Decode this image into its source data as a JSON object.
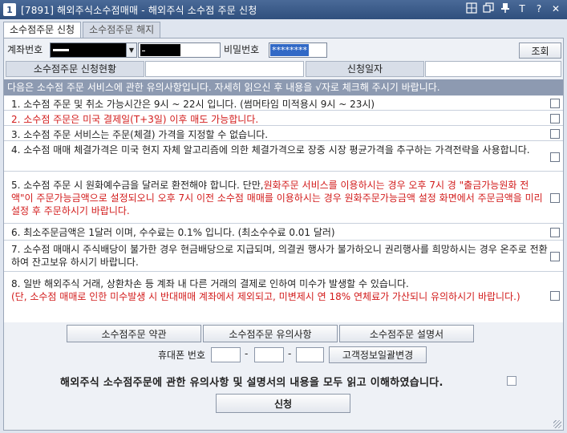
{
  "window": {
    "number": "1",
    "title": "[7891] 해외주식소수점매매 - 해외주식 소수점 주문 신청",
    "icons": [
      "grid-icon",
      "restore-window-icon",
      "pin-icon",
      "text-size-icon",
      "help-icon",
      "close-icon"
    ],
    "icon_glyphs": {
      "text": "T",
      "help": "?",
      "close": "✕"
    }
  },
  "tabs": [
    {
      "label": "소수점주문 신청",
      "active": true
    },
    {
      "label": "소수점주문 해지",
      "active": false
    }
  ],
  "account": {
    "label": "계좌번호",
    "password_label": "비밀번호",
    "password_value": "********",
    "query_button": "조회"
  },
  "status": {
    "application_status_label": "소수점주문 신청현황",
    "application_status_value": "",
    "application_date_label": "신청일자",
    "application_date_value": ""
  },
  "intro_text": "다음은 소수점 주문 서비스에 관한 유의사항입니다. 자세히 읽으신 후 내용을 √자로 체크해 주시기 바랍니다.",
  "notices": [
    {
      "text": "1. 소수점 주문 및 취소 가능시간은 9시 ~ 22시 입니다. (썸머타임 미적용시 9시 ~ 23시)",
      "checked": false
    },
    {
      "text": "2. 소수점 주문은 미국 결제일(T+3일) 이후 매도 가능합니다.",
      "checked": false
    },
    {
      "text": "3. 소수점 주문 서비스는 주문(체결) 가격을 지정할 수 없습니다.",
      "checked": false
    },
    {
      "text": "4. 소수점 매매 체결가격은 미국 현지 자체 알고리즘에 의한 체결가격으로 장중 시장 평균가격을 추구하는 가격전략을 사용합니다.",
      "checked": false
    },
    {
      "text_black": "5. 소수점 주문 시 원화예수금을 달러로 환전해야 합니다. 단만,",
      "text_red": "원화주문 서비스를 이용하시는 경우 오후 7시 경 \"출금가능원화 전액\"이 주문가능금액으로 설정되오니 오후 7시 이전 소수점 매매를 이용하시는 경우 원화주문가능금액 설정 화면에서 주문금액을 미리 설정 후 주문하시기 바랍니다.",
      "checked": false
    },
    {
      "text": "6. 최소주문금액은 1달러 이며, 수수료는 0.1% 입니다. (최소수수료 0.01 달러)",
      "checked": false
    },
    {
      "text": "7. 소수점 매매시 주식배당이 불가한 경우 현금배당으로 지급되며, 의결권 행사가 불가하오니 권리행사를 희망하시는 경우 온주로 전환하여 잔고보유 하시기 바랍니다.",
      "checked": false
    },
    {
      "text_black": "8. 일반 해외주식 거래, 상환차손 등 계좌 내 다른 거래의 결제로 인하여 미수가 발생할 수 있습니다.",
      "text_red": "(단, 소수점 매매로 인한 미수발생 시 반대매매 계좌에서 제외되고, 미변제시 연 18% 연체료가 가산되니 유의하시기 바랍니다.)",
      "checked": false
    }
  ],
  "buttons": {
    "terms": "소수점주문 약관",
    "precautions": "소수점주문 유의사항",
    "manual": "소수점주문 설명서"
  },
  "phone": {
    "label": "휴대폰 번호",
    "part1": "",
    "part2": "",
    "part3": "",
    "separator": "-",
    "change_button": "고객정보일괄변경"
  },
  "agreement": {
    "text": "해외주식 소수점주문에 관한 유의사항 및 설명서의 내용을 모두 읽고 이해하였습니다.",
    "checked": false
  },
  "submit_button": "신청"
}
